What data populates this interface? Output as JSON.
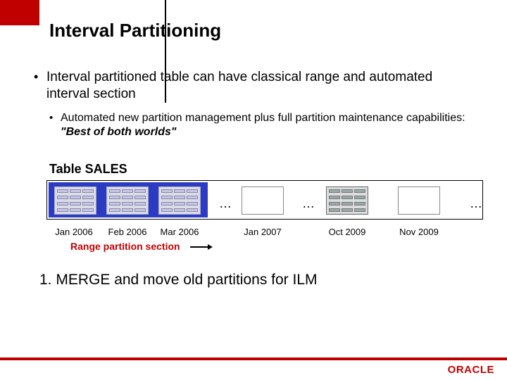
{
  "title": "Interval Partitioning",
  "bullet1": "Interval partitioned table can have classical range and automated interval section",
  "sub1_prefix": "Automated new partition management plus full partition maintenance capabilities: ",
  "sub1_emph": "\"Best of both worlds\"",
  "table_label": "Table SALES",
  "partitions": {
    "p0": "Jan 2006",
    "p1": "Feb 2006",
    "p2": "Mar 2006",
    "p3": "Jan 2007",
    "p4": "Oct 2009",
    "p5": "Nov 2009"
  },
  "ellipsis": "…",
  "range_section": "Range partition section",
  "step": "1. MERGE and move old partitions for ILM",
  "logo": "ORACLE"
}
